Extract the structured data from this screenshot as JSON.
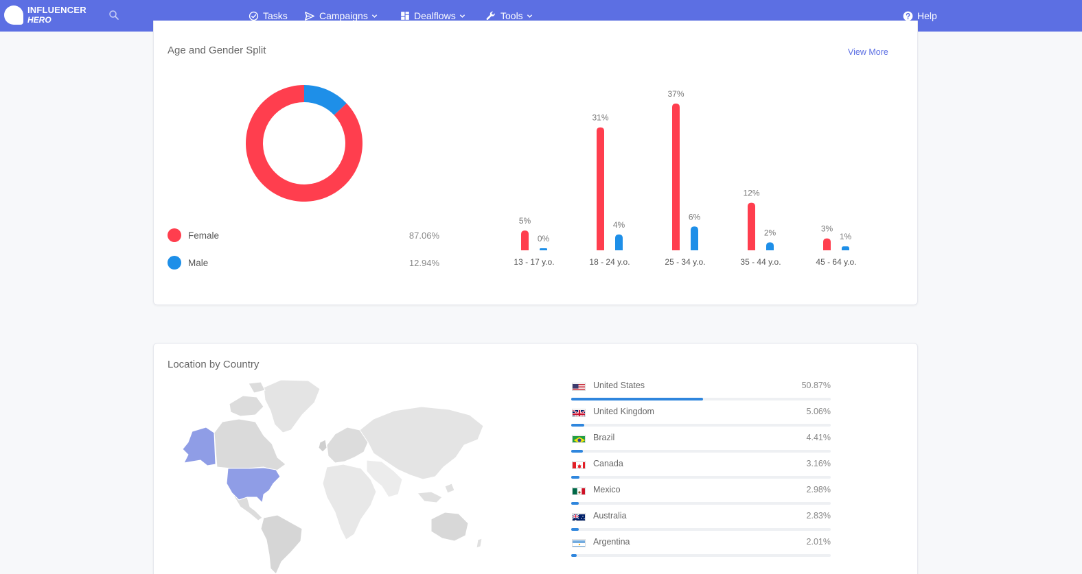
{
  "brand": {
    "line1": "INFLUENCER",
    "line2": "HERO"
  },
  "nav": {
    "tasks": "Tasks",
    "campaigns": "Campaigns",
    "dealflows": "Dealflows",
    "tools": "Tools",
    "help": "Help"
  },
  "colors": {
    "nav_bg": "#5c6fe3",
    "female": "#ff3e4e",
    "male": "#1e8fe8",
    "bar_fill": "#2f86dd",
    "map_highlight": "#8f9de6"
  },
  "age_gender": {
    "title": "Age and Gender Split",
    "view_more": "View More",
    "legend": [
      {
        "label": "Female",
        "value": "87.06%",
        "color": "#ff3e4e"
      },
      {
        "label": "Male",
        "value": "12.94%",
        "color": "#1e8fe8"
      }
    ]
  },
  "chart_data": [
    {
      "type": "pie",
      "labels": [
        "Female",
        "Male"
      ],
      "values": [
        87.06,
        12.94
      ],
      "donut": true
    },
    {
      "type": "bar",
      "categories": [
        "13 - 17 y.o.",
        "18 - 24 y.o.",
        "25 - 34 y.o.",
        "35 - 44 y.o.",
        "45 - 64 y.o."
      ],
      "series": [
        {
          "name": "Female",
          "values": [
            5,
            31,
            37,
            12,
            3
          ],
          "labels": [
            "5%",
            "31%",
            "37%",
            "12%",
            "3%"
          ]
        },
        {
          "name": "Male",
          "values": [
            0,
            4,
            6,
            2,
            1
          ],
          "labels": [
            "0%",
            "4%",
            "6%",
            "2%",
            "1%"
          ]
        }
      ],
      "ylim": [
        0,
        37
      ]
    }
  ],
  "location": {
    "title": "Location by Country",
    "countries": [
      {
        "name": "United States",
        "value": "50.87%",
        "pct": 50.87,
        "flag": "us-flag-icon"
      },
      {
        "name": "United Kingdom",
        "value": "5.06%",
        "pct": 5.06,
        "flag": "uk-flag-icon"
      },
      {
        "name": "Brazil",
        "value": "4.41%",
        "pct": 4.41,
        "flag": "brazil-flag-icon"
      },
      {
        "name": "Canada",
        "value": "3.16%",
        "pct": 3.16,
        "flag": "canada-flag-icon"
      },
      {
        "name": "Mexico",
        "value": "2.98%",
        "pct": 2.98,
        "flag": "mexico-flag-icon"
      },
      {
        "name": "Australia",
        "value": "2.83%",
        "pct": 2.83,
        "flag": "australia-flag-icon"
      },
      {
        "name": "Argentina",
        "value": "2.01%",
        "pct": 2.01,
        "flag": "argentina-flag-icon"
      }
    ]
  }
}
